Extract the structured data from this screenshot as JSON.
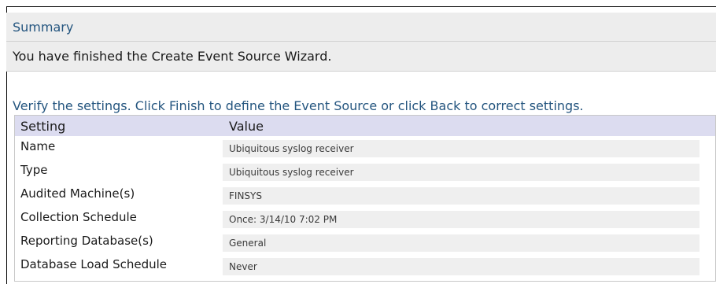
{
  "summary": {
    "title": "Summary"
  },
  "finished": {
    "text": "You have finished the Create Event Source Wizard."
  },
  "verify": {
    "text": "Verify the settings. Click Finish to define the Event Source or click Back to correct settings."
  },
  "table": {
    "headers": {
      "setting": "Setting",
      "value": "Value"
    },
    "rows": [
      {
        "setting": "Name",
        "value": "Ubiquitous syslog receiver"
      },
      {
        "setting": "Type",
        "value": "Ubiquitous syslog receiver"
      },
      {
        "setting": "Audited Machine(s)",
        "value": "FINSYS"
      },
      {
        "setting": "Collection Schedule",
        "value": "Once: 3/14/10 7:02 PM"
      },
      {
        "setting": "Reporting Database(s)",
        "value": "General"
      },
      {
        "setting": "Database Load Schedule",
        "value": "Never"
      }
    ]
  },
  "colors": {
    "title_blue": "#24557f",
    "header_gray": "#ededed",
    "table_header": "#dcdcf0",
    "value_cell": "#efefef"
  }
}
